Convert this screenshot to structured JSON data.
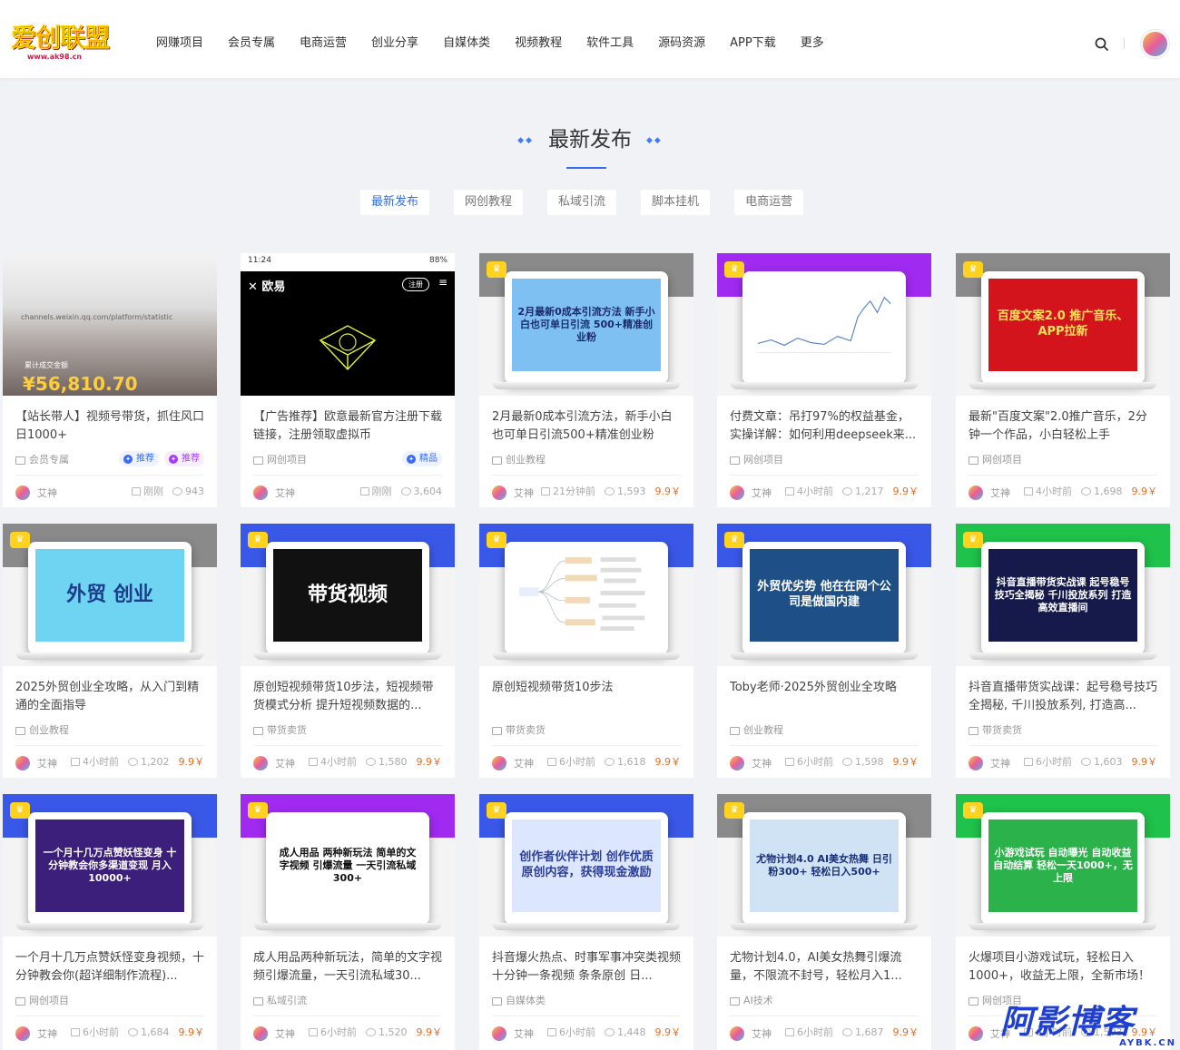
{
  "header": {
    "logo_main": "爱创联盟",
    "logo_sub": "www.ak98.cn",
    "nav": [
      "网赚项目",
      "会员专属",
      "电商运营",
      "创业分享",
      "自媒体类",
      "视频教程",
      "软件工具",
      "源码资源",
      "APP下载",
      "更多"
    ]
  },
  "section": {
    "title": "最新发布",
    "tabs": [
      "最新发布",
      "网创教程",
      "私域引流",
      "脚本挂机",
      "电商运营"
    ],
    "active_tab": 0
  },
  "colors": {
    "accent": "#2f6ff0",
    "price": "#f26a1b",
    "vip": "#ffd21f"
  },
  "cards": [
    {
      "title": "【站长带人】视频号带货，抓住风口日1000+",
      "category": "会员专属",
      "author": "艾神",
      "time": "刚刚",
      "views": "943",
      "price": "",
      "tags": [
        {
          "label": "推荐",
          "color": "blue"
        },
        {
          "label": "推荐",
          "color": "purple"
        }
      ],
      "thumb": {
        "type": "photo",
        "text": "¥56,810.70",
        "caption": "累计成交金额",
        "url_text": "channels.weixin.qq.com/platform/statistic"
      }
    },
    {
      "title": "【广告推荐】欧意最新官方注册下载链接，注册领取虚拟币",
      "category": "网创项目",
      "author": "艾神",
      "time": "刚刚",
      "views": "3,604",
      "price": "",
      "tags": [
        {
          "label": "精品",
          "color": "blue"
        }
      ],
      "thumb": {
        "type": "app",
        "status_time": "11:24",
        "status_right": "88%",
        "brand": "欧易",
        "button": "注册"
      }
    },
    {
      "title": "2月最新0成本引流方法，新手小白也可单日引流500+精准创业粉",
      "category": "创业教程",
      "author": "艾神",
      "time": "21分钟前",
      "views": "1,593",
      "price": "9.9￥",
      "tags": [],
      "thumb": {
        "type": "laptop",
        "text": "2月最新0成本引流方法 新手小白也可单日引流 500+精准创业粉",
        "top": "#8a8a8a",
        "bg": "#7fc0f2",
        "fg": "#1b2a6b"
      }
    },
    {
      "title": "付费文章：吊打97%的权益基金，实操详解：如何利用deepseek来...",
      "category": "网创项目",
      "author": "艾神",
      "time": "4小时前",
      "views": "1,217",
      "price": "9.9￥",
      "tags": [],
      "thumb": {
        "type": "chart",
        "text": "",
        "top": "#a02af0",
        "bg": "#ffffff",
        "fg": "#333"
      }
    },
    {
      "title": "最新\"百度文案\"2.0推广音乐，2分钟一个作品，小白轻松上手",
      "category": "网创项目",
      "author": "艾神",
      "time": "4小时前",
      "views": "1,698",
      "price": "9.9￥",
      "tags": [],
      "thumb": {
        "type": "laptop",
        "text": "百度文案2.0 推广音乐、APP拉新",
        "top": "#8a8a8a",
        "bg": "#d4141c",
        "fg": "#ffe25a"
      }
    },
    {
      "title": "2025外贸创业全攻略，从入门到精通的全面指导",
      "category": "创业教程",
      "author": "艾神",
      "time": "4小时前",
      "views": "1,202",
      "price": "9.9￥",
      "tags": [],
      "thumb": {
        "type": "laptop",
        "text": "外贸 创业",
        "top": "#8a8a8a",
        "bg": "#6fd3f2",
        "fg": "#1d3d8a"
      }
    },
    {
      "title": "原创短视频带货10步法，短视频带货模式分析 提升短视频数据的...",
      "category": "带货卖货",
      "author": "艾神",
      "time": "4小时前",
      "views": "1,580",
      "price": "9.9￥",
      "tags": [],
      "thumb": {
        "type": "laptop",
        "text": "带货视频",
        "top": "#3a58e8",
        "bg": "#111111",
        "fg": "#ffffff"
      }
    },
    {
      "title": "原创短视频带货10步法",
      "category": "带货卖货",
      "author": "艾神",
      "time": "6小时前",
      "views": "1,618",
      "price": "9.9￥",
      "tags": [],
      "thumb": {
        "type": "mindmap",
        "text": "",
        "top": "#3a58e8",
        "bg": "#ffffff",
        "fg": "#555"
      }
    },
    {
      "title": "Toby老师·2025外贸创业全攻略",
      "category": "创业教程",
      "author": "艾神",
      "time": "6小时前",
      "views": "1,598",
      "price": "9.9￥",
      "tags": [],
      "thumb": {
        "type": "laptop",
        "text": "外贸优劣势 他在在网个公司是做国内建",
        "top": "#3a58e8",
        "bg": "#1e4f86",
        "fg": "#ffffff"
      }
    },
    {
      "title": "抖音直播带货实战课：起号稳号技巧全揭秘, 千川投放系列, 打造高...",
      "category": "带货卖货",
      "author": "艾神",
      "time": "6小时前",
      "views": "1,603",
      "price": "9.9￥",
      "tags": [],
      "thumb": {
        "type": "laptop",
        "text": "抖音直播带货实战课 起号稳号技巧全揭秘 千川投放系列 打造高效直播间",
        "top": "#1fc24a",
        "bg": "#151a4a",
        "fg": "#ffffff"
      }
    },
    {
      "title": "一个月十几万点赞妖怪变身视频，十分钟教会你(超详细制作流程)...",
      "category": "网创项目",
      "author": "艾神",
      "time": "6小时前",
      "views": "1,684",
      "price": "9.9￥",
      "tags": [],
      "thumb": {
        "type": "laptop",
        "text": "一个月十几万点赞妖怪变身 十分钟教会你多渠道变现 月入10000+",
        "top": "#3a58e8",
        "bg": "#3b1f7a",
        "fg": "#ffffff"
      }
    },
    {
      "title": "成人用品两种新玩法，简单的文字视频引爆流量，一天引流私域30...",
      "category": "私域引流",
      "author": "艾神",
      "time": "6小时前",
      "views": "1,520",
      "price": "9.9￥",
      "tags": [],
      "thumb": {
        "type": "laptop",
        "text": "成人用品 两种新玩法 简单的文字视频 引爆流量 一天引流私域300+",
        "top": "#a02af0",
        "bg": "#ffffff",
        "fg": "#111111"
      }
    },
    {
      "title": "抖音爆火热点、时事军事冲突类视频 十分钟一条视频 条条原创 日...",
      "category": "自媒体类",
      "author": "艾神",
      "time": "6小时前",
      "views": "1,448",
      "price": "9.9￥",
      "tags": [],
      "thumb": {
        "type": "laptop",
        "text": "创作者伙伴计划 创作优质原创内容，获得现金激励",
        "top": "#3a58e8",
        "bg": "#dde6ff",
        "fg": "#2b3f9a"
      }
    },
    {
      "title": "尤物计划4.0，AI美女热舞引爆流量，不限流不封号，轻松月入1...",
      "category": "AI技术",
      "author": "艾神",
      "time": "6小时前",
      "views": "1,687",
      "price": "9.9￥",
      "tags": [],
      "thumb": {
        "type": "laptop",
        "text": "尤物计划4.0 AI美女热舞 日引粉300+ 轻松日入500+",
        "top": "#8a8a8a",
        "bg": "#cfe3f5",
        "fg": "#1a2f7a"
      }
    },
    {
      "title": "火爆项目小游戏试玩，轻松日入1000+，收益无上限，全新市场！",
      "category": "网创项目",
      "author": "艾神",
      "time": "6小时前",
      "views": "1,503",
      "price": "9.9￥",
      "tags": [],
      "thumb": {
        "type": "laptop",
        "text": "小游戏试玩 自动曝光 自动收益 自动结算 轻松一天1000+，无上限",
        "top": "#1fc24a",
        "bg": "#2bb24a",
        "fg": "#ffffff"
      }
    }
  ],
  "watermark": {
    "main": "阿影博客",
    "sub": "AYBK.CN"
  }
}
